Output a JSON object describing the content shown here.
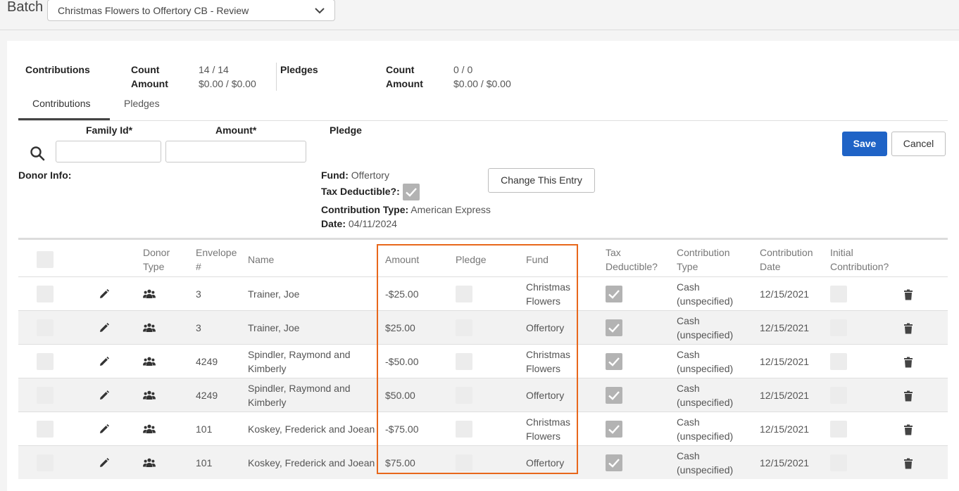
{
  "header": {
    "batch_label": "Batch",
    "batch_selected": "Christmas Flowers to Offertory CB - Review"
  },
  "summary": {
    "contributions_label": "Contributions",
    "count_label": "Count",
    "amount_label": "Amount",
    "contributions_count": "14 / 14",
    "contributions_amount": "$0.00 / $0.00",
    "pledges_label": "Pledges",
    "pledges_count": "0 / 0",
    "pledges_amount": "$0.00 / $0.00"
  },
  "tabs": [
    {
      "label": "Contributions",
      "active": true
    },
    {
      "label": "Pledges",
      "active": false
    }
  ],
  "entry_form": {
    "family_id_label": "Family Id*",
    "amount_label": "Amount*",
    "pledge_label": "Pledge",
    "family_id_value": "",
    "amount_value": "",
    "donor_info_label": "Donor Info:",
    "fund_label": "Fund:",
    "fund_value": "Offertory",
    "tax_deductible_label": "Tax Deductible?:",
    "tax_deductible_checked": true,
    "contribution_type_label": "Contribution Type:",
    "contribution_type_value": "American Express",
    "date_label": "Date:",
    "date_value": "04/11/2024",
    "change_entry_label": "Change This Entry",
    "save_label": "Save",
    "cancel_label": "Cancel"
  },
  "table": {
    "headers": {
      "donor_type": [
        "Donor",
        "Type"
      ],
      "envelope": [
        "Envelope",
        "#"
      ],
      "name": "Name",
      "amount": "Amount",
      "pledge": "Pledge",
      "fund": "Fund",
      "tax_deductible": [
        "Tax",
        "Deductible?"
      ],
      "contribution_type": [
        "Contribution",
        "Type"
      ],
      "contribution_date": [
        "Contribution",
        "Date"
      ],
      "initial_contribution": [
        "Initial",
        "Contribution?"
      ]
    },
    "rows": [
      {
        "envelope": "3",
        "name": [
          "Trainer, Joe"
        ],
        "amount": "-$25.00",
        "fund": [
          "Christmas",
          "Flowers"
        ],
        "contribution_type": [
          "Cash",
          "(unspecified)"
        ],
        "date": "12/15/2021",
        "tax_deductible": true
      },
      {
        "envelope": "3",
        "name": [
          "Trainer, Joe"
        ],
        "amount": "$25.00",
        "fund": [
          "Offertory"
        ],
        "contribution_type": [
          "Cash",
          "(unspecified)"
        ],
        "date": "12/15/2021",
        "tax_deductible": true
      },
      {
        "envelope": "4249",
        "name": [
          "Spindler, Raymond and",
          "Kimberly"
        ],
        "amount": "-$50.00",
        "fund": [
          "Christmas",
          "Flowers"
        ],
        "contribution_type": [
          "Cash",
          "(unspecified)"
        ],
        "date": "12/15/2021",
        "tax_deductible": true
      },
      {
        "envelope": "4249",
        "name": [
          "Spindler, Raymond and",
          "Kimberly"
        ],
        "amount": "$50.00",
        "fund": [
          "Offertory"
        ],
        "contribution_type": [
          "Cash",
          "(unspecified)"
        ],
        "date": "12/15/2021",
        "tax_deductible": true
      },
      {
        "envelope": "101",
        "name": [
          "Koskey, Frederick and Joean"
        ],
        "amount": "-$75.00",
        "fund": [
          "Christmas",
          "Flowers"
        ],
        "contribution_type": [
          "Cash",
          "(unspecified)"
        ],
        "date": "12/15/2021",
        "tax_deductible": true
      },
      {
        "envelope": "101",
        "name": [
          "Koskey, Frederick and Joean"
        ],
        "amount": "$75.00",
        "fund": [
          "Offertory"
        ],
        "contribution_type": [
          "Cash",
          "(unspecified)"
        ],
        "date": "12/15/2021",
        "tax_deductible": true
      }
    ]
  },
  "icons": {
    "search": "search-icon",
    "edit": "pencil-icon",
    "donor_type": "family-icon",
    "delete": "trash-icon",
    "dropdown": "chevron-down-icon"
  },
  "colors": {
    "primary": "#1f63c6",
    "highlight_border": "#e8671b",
    "checkbox_checked": "#b3b3b3",
    "checkbox_empty": "#ececec"
  }
}
